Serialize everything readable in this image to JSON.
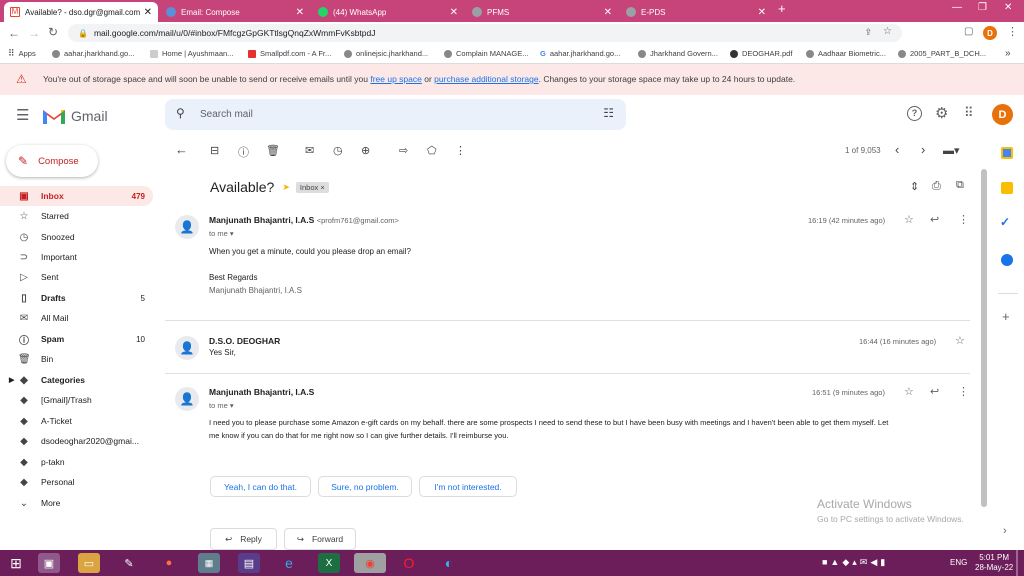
{
  "browser": {
    "tabs": [
      {
        "title": "Available? - dso.dgr@gmail.com",
        "icon": "gmail-icon",
        "active": true
      },
      {
        "title": "Email: Compose",
        "icon": "globe-icon",
        "active": false
      },
      {
        "title": "(44) WhatsApp",
        "icon": "whatsapp-icon",
        "active": false
      },
      {
        "title": "PFMS",
        "icon": "globe-icon",
        "active": false
      },
      {
        "title": "E-PDS",
        "icon": "globe-icon",
        "active": false
      }
    ],
    "new_tab": "+",
    "url": "mail.google.com/mail/u/0/#inbox/FMfcgzGpGKTtlsgQnqZxWmmFvKsbtpdJ",
    "profile_letter": "D",
    "bookmarks": [
      "Apps",
      "aahar.jharkhand.go...",
      "Home | Ayushmaan...",
      "Smallpdf.com - A Fr...",
      "onlinejsic.jharkhand...",
      "Complain MANAGE...",
      "aahar.jharkhand.go...",
      "Jharkhand Govern...",
      "DEOGHAR.pdf",
      "Aadhaar Biometric...",
      "2005_PART_B_DCH..."
    ],
    "bookmarks_more": "»"
  },
  "banner": {
    "text1": "You're out of storage space and will soon be unable to send or receive emails until you ",
    "link1": "free up space",
    "text2": " or ",
    "link2": "purchase additional storage",
    "text3": ". Changes to your storage space may take up to 24 hours to update."
  },
  "gmail": {
    "logo_text": "Gmail",
    "search_placeholder": "Search mail",
    "avatar_letter": "D"
  },
  "sidebar": {
    "compose": "Compose",
    "items": [
      {
        "label": "Inbox",
        "count": "479",
        "icon": "inbox-icon",
        "selected": true
      },
      {
        "label": "Starred",
        "count": "",
        "icon": "star-icon"
      },
      {
        "label": "Snoozed",
        "count": "",
        "icon": "clock-icon"
      },
      {
        "label": "Important",
        "count": "",
        "icon": "important-icon"
      },
      {
        "label": "Sent",
        "count": "",
        "icon": "send-icon"
      },
      {
        "label": "Drafts",
        "count": "5",
        "icon": "draft-icon",
        "bold": true
      },
      {
        "label": "All Mail",
        "count": "",
        "icon": "mail-icon"
      },
      {
        "label": "Spam",
        "count": "10",
        "icon": "spam-icon",
        "bold": true
      },
      {
        "label": "Bin",
        "count": "",
        "icon": "trash-icon"
      },
      {
        "label": "Categories",
        "count": "",
        "icon": "label-icon",
        "bold": true
      },
      {
        "label": "[Gmail]/Trash",
        "count": "",
        "icon": "label-icon"
      },
      {
        "label": "A-Ticket",
        "count": "",
        "icon": "label-icon"
      },
      {
        "label": "dsodeoghar2020@gmai...",
        "count": "",
        "icon": "label-icon"
      },
      {
        "label": "p-takn",
        "count": "",
        "icon": "label-icon"
      },
      {
        "label": "Personal",
        "count": "",
        "icon": "label-icon"
      },
      {
        "label": "More",
        "count": "",
        "icon": "chevron-down-icon"
      }
    ]
  },
  "toolbar": {
    "pagination": "1 of 9,053"
  },
  "thread": {
    "subject": "Available?",
    "label": "Inbox",
    "messages": [
      {
        "sender": "Manjunath Bhajantri, I.A.S",
        "email": "<profm761@gmail.com>",
        "to": "to me",
        "time": "16:19 (42 minutes ago)",
        "body": [
          "When you get a minute, could you please drop an email?",
          "",
          "Best Regards"
        ],
        "signature": "Manjunath Bhajantri, I.A.S"
      },
      {
        "sender": "D.S.O. DEOGHAR",
        "time": "16:44 (16 minutes ago)",
        "snippet": "Yes Sir,"
      },
      {
        "sender": "Manjunath Bhajantri, I.A.S",
        "to": "to me",
        "time": "16:51 (9 minutes ago)",
        "body1": "I need you to please purchase some Amazon e-gift cards on my behalf. there are some prospects I need to send these to but I have been busy with meetings and I haven't been able to get them myself. Let",
        "body2": "me know if you can do that for me right now so I can give further details. I'll reimburse you."
      }
    ],
    "smart_replies": [
      "Yeah, I can do that.",
      "Sure, no problem.",
      "I'm not interested."
    ],
    "reply": "Reply",
    "forward": "Forward"
  },
  "windows": {
    "activate_title": "Activate Windows",
    "activate_sub": "Go to PC settings to activate Windows.",
    "lang": "ENG",
    "time": "5:01 PM",
    "date": "28-May-22"
  }
}
